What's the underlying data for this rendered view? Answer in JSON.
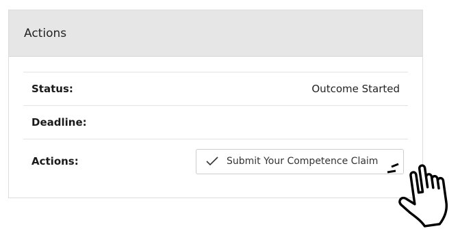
{
  "panel": {
    "title": "Actions"
  },
  "rows": {
    "status": {
      "label": "Status:",
      "value": "Outcome Started"
    },
    "deadline": {
      "label": "Deadline:",
      "value": ""
    },
    "actions": {
      "label": "Actions:"
    }
  },
  "submit_button": {
    "label": "Submit Your Competence Claim",
    "icon": "check-icon"
  },
  "cursor": {
    "icon": "hand-pointer-icon"
  }
}
